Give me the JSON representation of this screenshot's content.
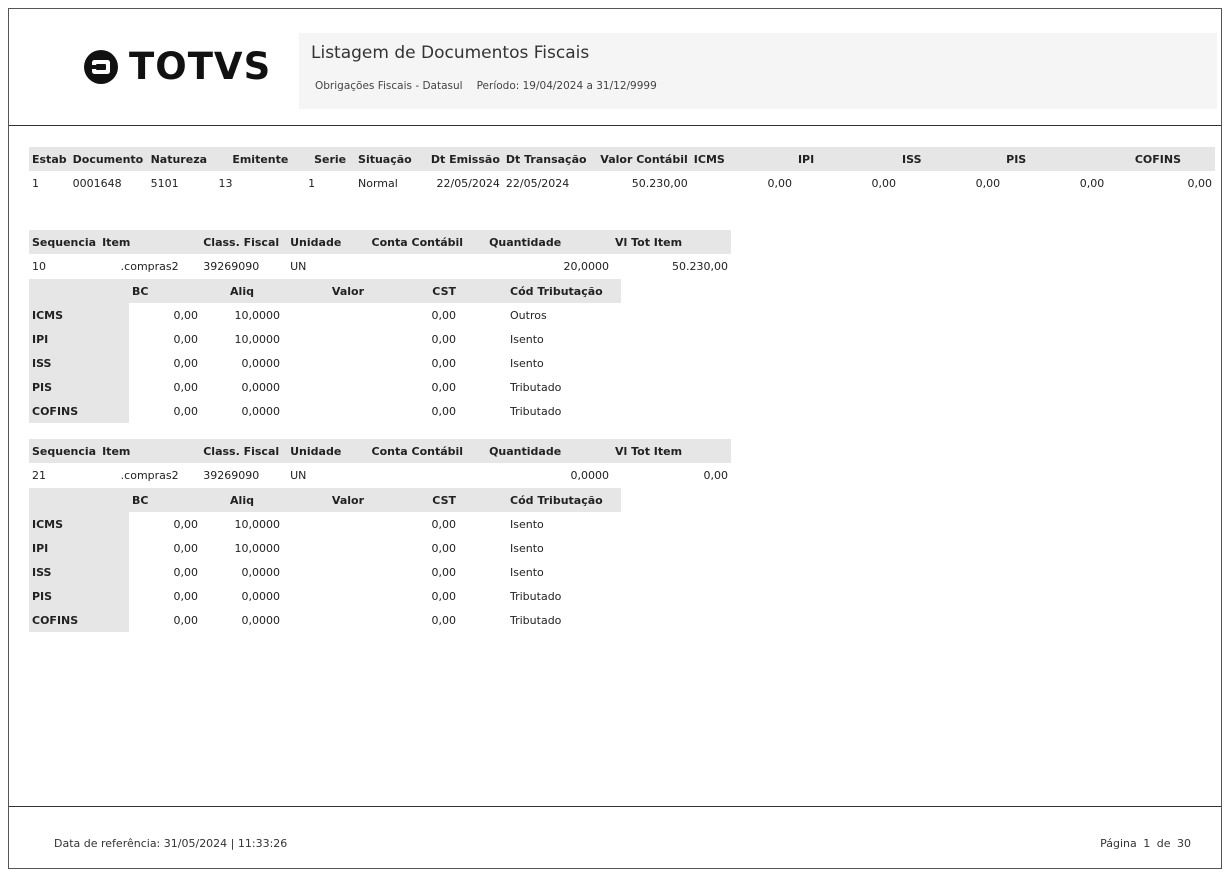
{
  "header": {
    "logo_text": "TOTVS",
    "title": "Listagem de Documentos Fiscais",
    "subtitle_left": "Obrigações Fiscais - Datasul",
    "periodo_label": "Período:",
    "periodo_value": "19/04/2024 a 31/12/9999"
  },
  "doc_table": {
    "headers": [
      "Estab",
      "Documento",
      "Natureza",
      "Emitente",
      "Serie",
      "Situação",
      "Dt Emissão",
      "Dt Transação",
      "Valor Contábil",
      "ICMS",
      "IPI",
      "ISS",
      "PIS",
      "COFINS"
    ],
    "row": [
      "1",
      "0001648",
      "5101",
      "13",
      "1",
      "Normal",
      "22/05/2024",
      "22/05/2024",
      "50.230,00",
      "0,00",
      "0,00",
      "0,00",
      "0,00",
      "0,00"
    ]
  },
  "item_headers": [
    "Sequencia",
    "Item",
    "Class. Fiscal",
    "Unidade",
    "Conta Contábil",
    "Quantidade",
    "Vl Tot Item"
  ],
  "tax_headers": [
    "BC",
    "Aliq",
    "Valor",
    "CST",
    "Cód Tributação"
  ],
  "items": [
    {
      "row": [
        "10",
        ".compras2",
        "39269090",
        "UN",
        "",
        "20,0000",
        "50.230,00"
      ],
      "taxes": [
        {
          "name": "ICMS",
          "bc": "0,00",
          "aliq": "10,0000",
          "valor": "0,00",
          "cst": "",
          "cod": "Outros"
        },
        {
          "name": "IPI",
          "bc": "0,00",
          "aliq": "10,0000",
          "valor": "0,00",
          "cst": "",
          "cod": "Isento"
        },
        {
          "name": "ISS",
          "bc": "0,00",
          "aliq": "0,0000",
          "valor": "0,00",
          "cst": "",
          "cod": "Isento"
        },
        {
          "name": "PIS",
          "bc": "0,00",
          "aliq": "0,0000",
          "valor": "0,00",
          "cst": "",
          "cod": "Tributado"
        },
        {
          "name": "COFINS",
          "bc": "0,00",
          "aliq": "0,0000",
          "valor": "0,00",
          "cst": "",
          "cod": "Tributado"
        }
      ]
    },
    {
      "row": [
        "21",
        ".compras2",
        "39269090",
        "UN",
        "",
        "0,0000",
        "0,00"
      ],
      "taxes": [
        {
          "name": "ICMS",
          "bc": "0,00",
          "aliq": "10,0000",
          "valor": "0,00",
          "cst": "",
          "cod": "Isento"
        },
        {
          "name": "IPI",
          "bc": "0,00",
          "aliq": "10,0000",
          "valor": "0,00",
          "cst": "",
          "cod": "Isento"
        },
        {
          "name": "ISS",
          "bc": "0,00",
          "aliq": "0,0000",
          "valor": "0,00",
          "cst": "",
          "cod": "Isento"
        },
        {
          "name": "PIS",
          "bc": "0,00",
          "aliq": "0,0000",
          "valor": "0,00",
          "cst": "",
          "cod": "Tributado"
        },
        {
          "name": "COFINS",
          "bc": "0,00",
          "aliq": "0,0000",
          "valor": "0,00",
          "cst": "",
          "cod": "Tributado"
        }
      ]
    }
  ],
  "footer": {
    "ref_label": "Data de referência:",
    "ref_value": "31/05/2024 | 11:33:26",
    "page_label": "Página",
    "page_current": "1",
    "page_of": "de",
    "page_total": "30"
  }
}
